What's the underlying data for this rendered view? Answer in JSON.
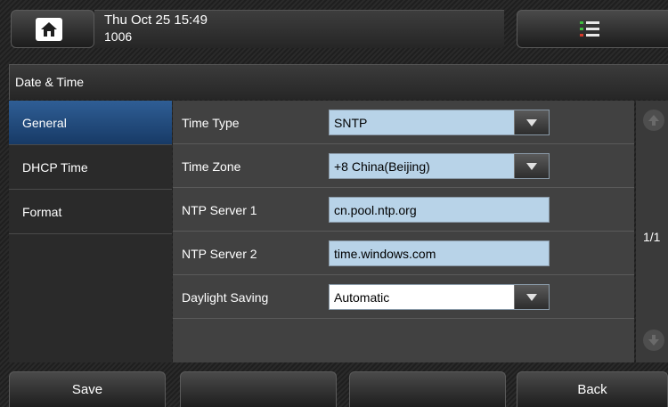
{
  "status": {
    "datetime": "Thu Oct 25 15:49",
    "extension": "1006"
  },
  "title": "Date & Time",
  "sidebar": {
    "items": [
      {
        "label": "General",
        "active": true
      },
      {
        "label": "DHCP Time",
        "active": false
      },
      {
        "label": "Format",
        "active": false
      }
    ]
  },
  "settings": [
    {
      "label": "Time Type",
      "value": "SNTP",
      "kind": "dropdown"
    },
    {
      "label": "Time Zone",
      "value": "+8 China(Beijing)",
      "kind": "dropdown"
    },
    {
      "label": "NTP Server 1",
      "value": "cn.pool.ntp.org",
      "kind": "text"
    },
    {
      "label": "NTP Server 2",
      "value": "time.windows.com",
      "kind": "text"
    },
    {
      "label": "Daylight Saving",
      "value": "Automatic",
      "kind": "dropdown"
    }
  ],
  "pager": {
    "page": "1/1"
  },
  "softkeys": {
    "key1": "Save",
    "key2": "",
    "key3": "",
    "key4": "Back"
  },
  "icons": {
    "home": "home-icon",
    "menu": "menu-list-icon",
    "up": "arrow-up-icon",
    "down": "arrow-down-icon"
  },
  "colors": {
    "active_item": "#2f5e95",
    "field_bg": "#b8d3e8",
    "menu_dot_green": "#3fbf3f",
    "menu_dot_red": "#d83a2a"
  }
}
